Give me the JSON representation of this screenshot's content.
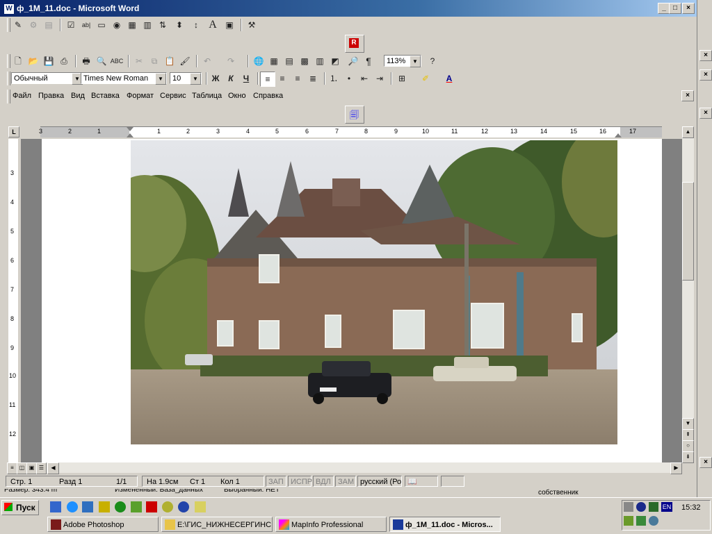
{
  "window": {
    "title": "ф_1М_11.doc - Microsoft Word",
    "minimize": "_",
    "maximize": "□",
    "close": "×"
  },
  "format_toolbar": {
    "style": "Обычный",
    "font": "Times New Roman",
    "size": "10",
    "bold": "Ж",
    "italic": "К",
    "underline": "Ч"
  },
  "standard_toolbar": {
    "zoom": "113%"
  },
  "menu": {
    "items": [
      "Файл",
      "Правка",
      "Вид",
      "Вставка",
      "Формат",
      "Сервис",
      "Таблица",
      "Окно",
      "Справка"
    ]
  },
  "ruler": {
    "h_numbers": [
      "3",
      "2",
      "1",
      "1",
      "2",
      "3",
      "4",
      "5",
      "6",
      "7",
      "8",
      "9",
      "10",
      "11",
      "12",
      "13",
      "14",
      "15",
      "16",
      "17"
    ],
    "v_numbers": [
      "3",
      "4",
      "5",
      "6",
      "7",
      "8",
      "9",
      "10",
      "11",
      "12"
    ]
  },
  "statusbar": {
    "page": "Стр. 1",
    "section": "Разд 1",
    "pages": "1/1",
    "at": "На 1.9см",
    "line": "Ст 1",
    "col": "Кол 1",
    "rec": "ЗАП",
    "trk": "ИСПР",
    "ext": "ВДЛ",
    "ovr": "ЗАМ",
    "lang": "русский (Ро"
  },
  "behind_window": {
    "size_text": "Размер: 343.4 m",
    "changed_text": "Измененный: База_данных",
    "selected_text": "Выбранный: НЕТ",
    "owner_text": "собственник"
  },
  "taskbar": {
    "start": "Пуск",
    "items": [
      {
        "label": "Adobe Photoshop"
      },
      {
        "label": "E:\\ГИС_НИЖНЕСЕРГИНС..."
      },
      {
        "label": "MapInfo Professional"
      },
      {
        "label": "ф_1М_11.doc - Micros..."
      }
    ],
    "lang": "EN",
    "clock": "15:32"
  },
  "colors": {
    "titlebar_start": "#0a246a",
    "titlebar_end": "#a6caf0",
    "face": "#d4d0c8"
  }
}
